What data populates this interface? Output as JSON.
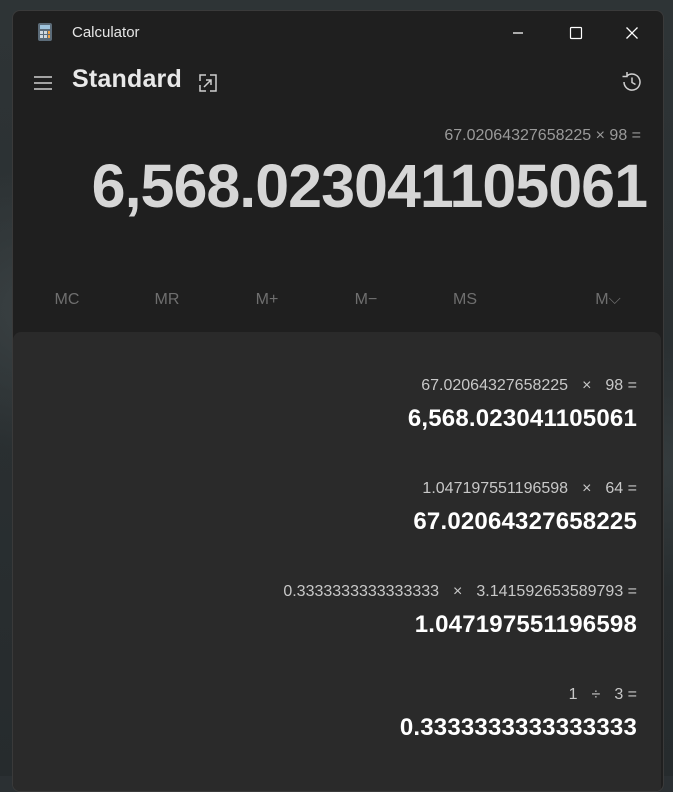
{
  "window": {
    "title": "Calculator"
  },
  "header": {
    "mode": "Standard"
  },
  "display": {
    "expression": "67.02064327658225 × 98 =",
    "result": "6,568.023041105061"
  },
  "memory": [
    "MC",
    "MR",
    "M+",
    "M−",
    "MS",
    "M⌵"
  ],
  "history": [
    {
      "a": "67.02064327658225",
      "op": "×",
      "b": "98 =",
      "result": "6,568.023041105061"
    },
    {
      "a": "1.047197551196598",
      "op": "×",
      "b": "64 =",
      "result": "67.02064327658225"
    },
    {
      "a": "0.3333333333333333",
      "op": "×",
      "b": "3.141592653589793 =",
      "result": "1.047197551196598"
    },
    {
      "a": "1",
      "op": "÷",
      "b": "3 =",
      "result": "0.3333333333333333"
    }
  ],
  "icons": {
    "app": "calculator-app-icon",
    "menu": "hamburger-menu-icon",
    "keep_on_top": "keep-on-top-icon",
    "history": "history-icon",
    "minimize": "minimize-icon",
    "maximize": "maximize-icon",
    "close": "close-icon"
  }
}
